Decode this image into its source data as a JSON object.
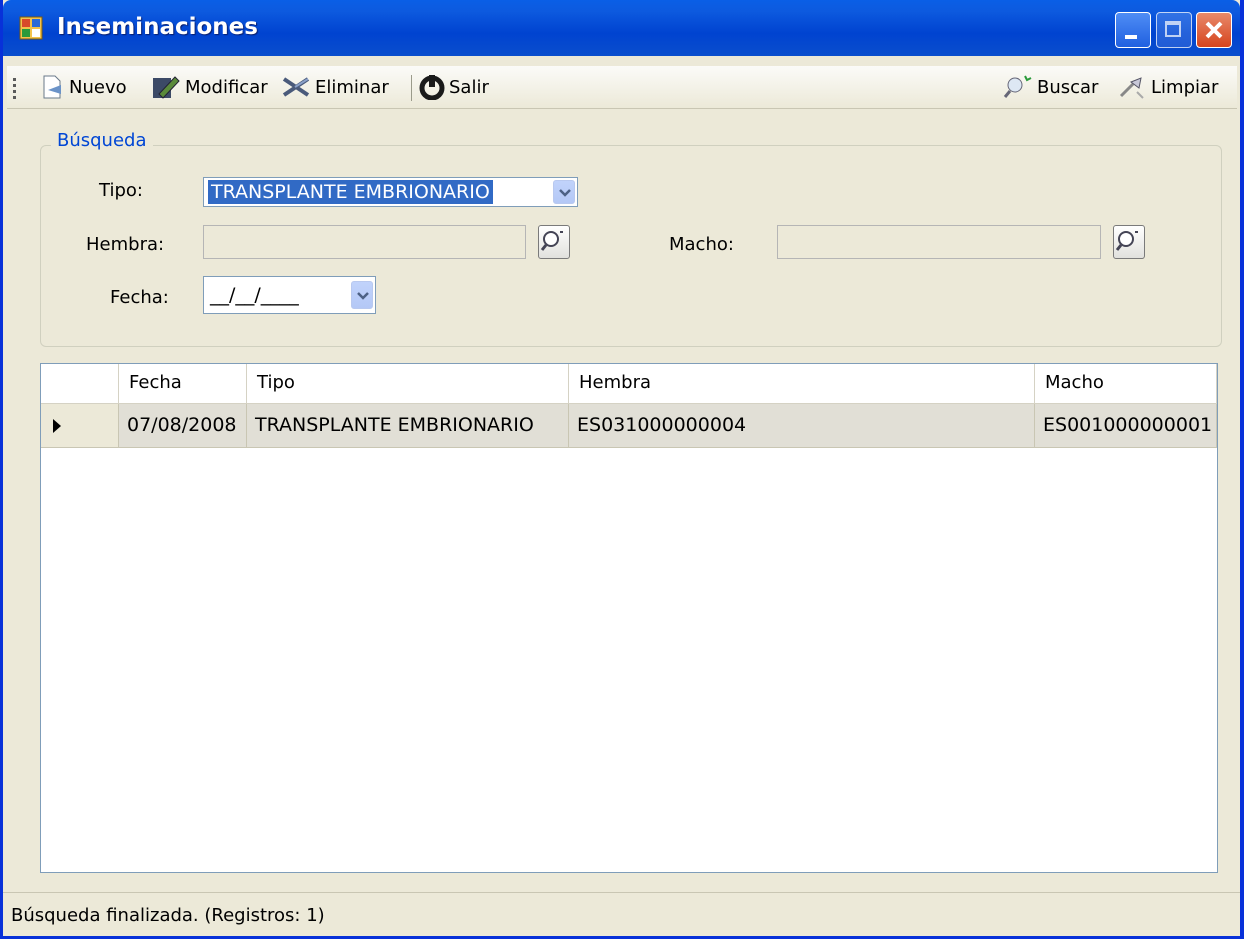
{
  "window": {
    "title": "Inseminaciones"
  },
  "toolbar": {
    "nuevo": "Nuevo",
    "modificar": "Modificar",
    "eliminar": "Eliminar",
    "salir": "Salir",
    "buscar": "Buscar",
    "limpiar": "Limpiar"
  },
  "search": {
    "legend": "Búsqueda",
    "tipo_label": "Tipo:",
    "tipo_value": "TRANSPLANTE EMBRIONARIO",
    "hembra_label": "Hembra:",
    "hembra_value": "",
    "macho_label": "Macho:",
    "macho_value": "",
    "fecha_label": "Fecha:",
    "fecha_value": "__/__/____"
  },
  "grid": {
    "columns": [
      "Fecha",
      "Tipo",
      "Hembra",
      "Macho"
    ],
    "rows": [
      {
        "fecha": "07/08/2008",
        "tipo": "TRANSPLANTE EMBRIONARIO",
        "hembra": "ES031000000004",
        "macho": "ES001000000001"
      }
    ]
  },
  "status": {
    "text": "Búsqueda finalizada. (Registros: 1)"
  },
  "colors": {
    "titlebar": "#0a5fe6",
    "selection": "#316ac5",
    "group_legend": "#0046d5"
  }
}
